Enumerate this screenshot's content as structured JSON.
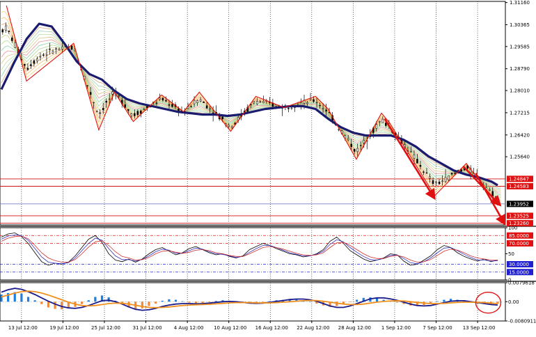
{
  "chart_data": [
    {
      "type": "candlestick",
      "panel": "price",
      "ylim": [
        1.232,
        1.312
      ],
      "y_ticks": [
        "1.31160",
        "1.30365",
        "1.29585",
        "1.28790",
        "1.28010",
        "1.27215",
        "1.26420",
        "1.25640"
      ],
      "price_tags": [
        "1.24847",
        "1.24583",
        "1.23952",
        "1.23525",
        "1.23260"
      ],
      "horizontal_levels": [
        1.24847,
        1.24583,
        1.23525,
        1.2326
      ],
      "current_level": 1.23952,
      "overlays": [
        "moving-average ribbon (many colored lines)",
        "thick navy moving average",
        "red zigzag"
      ],
      "annotations": [
        "three red down arrows"
      ],
      "zigzag_points": [
        {
          "t": 0.8,
          "price": 1.3105
        },
        {
          "t": 4.0,
          "price": 1.2835
        },
        {
          "t": 11.5,
          "price": 1.297
        },
        {
          "t": 15.5,
          "price": 1.266
        },
        {
          "t": 18.0,
          "price": 1.2795
        },
        {
          "t": 21.0,
          "price": 1.269
        },
        {
          "t": 25.5,
          "price": 1.2785
        },
        {
          "t": 29.0,
          "price": 1.2725
        },
        {
          "t": 31.5,
          "price": 1.2795
        },
        {
          "t": 36.5,
          "price": 1.2655
        },
        {
          "t": 40.5,
          "price": 1.278
        },
        {
          "t": 45.0,
          "price": 1.274
        },
        {
          "t": 50.0,
          "price": 1.278
        },
        {
          "t": 52.0,
          "price": 1.2735
        },
        {
          "t": 56.5,
          "price": 1.2555
        },
        {
          "t": 60.5,
          "price": 1.272
        },
        {
          "t": 61.8,
          "price": 1.2685
        },
        {
          "t": 69.0,
          "price": 1.2425
        },
        {
          "t": 74.0,
          "price": 1.254
        },
        {
          "t": 79.0,
          "price": 1.239
        }
      ],
      "ma_points": [
        {
          "t": 0.0,
          "price": 1.2805
        },
        {
          "t": 2.0,
          "price": 1.29
        },
        {
          "t": 4.0,
          "price": 1.2985
        },
        {
          "t": 6.0,
          "price": 1.304
        },
        {
          "t": 8.0,
          "price": 1.303
        },
        {
          "t": 10.0,
          "price": 1.297
        },
        {
          "t": 12.0,
          "price": 1.2905
        },
        {
          "t": 14.0,
          "price": 1.286
        },
        {
          "t": 16.0,
          "price": 1.284
        },
        {
          "t": 18.0,
          "price": 1.28
        },
        {
          "t": 20.0,
          "price": 1.277
        },
        {
          "t": 22.0,
          "price": 1.2755
        },
        {
          "t": 24.0,
          "price": 1.2745
        },
        {
          "t": 26.0,
          "price": 1.2735
        },
        {
          "t": 28.0,
          "price": 1.2725
        },
        {
          "t": 30.0,
          "price": 1.272
        },
        {
          "t": 32.0,
          "price": 1.2715
        },
        {
          "t": 34.0,
          "price": 1.2715
        },
        {
          "t": 36.0,
          "price": 1.271
        },
        {
          "t": 38.0,
          "price": 1.2715
        },
        {
          "t": 40.0,
          "price": 1.2725
        },
        {
          "t": 42.0,
          "price": 1.2735
        },
        {
          "t": 44.0,
          "price": 1.274
        },
        {
          "t": 46.0,
          "price": 1.2745
        },
        {
          "t": 48.0,
          "price": 1.2745
        },
        {
          "t": 50.0,
          "price": 1.2735
        },
        {
          "t": 52.0,
          "price": 1.27
        },
        {
          "t": 54.0,
          "price": 1.267
        },
        {
          "t": 56.0,
          "price": 1.265
        },
        {
          "t": 58.0,
          "price": 1.264
        },
        {
          "t": 60.0,
          "price": 1.264
        },
        {
          "t": 62.0,
          "price": 1.264
        },
        {
          "t": 64.0,
          "price": 1.2625
        },
        {
          "t": 66.0,
          "price": 1.26
        },
        {
          "t": 68.0,
          "price": 1.2565
        },
        {
          "t": 70.0,
          "price": 1.254
        },
        {
          "t": 72.0,
          "price": 1.2515
        },
        {
          "t": 74.0,
          "price": 1.25
        },
        {
          "t": 76.0,
          "price": 1.249
        },
        {
          "t": 78.0,
          "price": 1.2475
        },
        {
          "t": 79.0,
          "price": 1.2462
        }
      ],
      "arrows": [
        {
          "from": {
            "t": 61.0,
            "price": 1.27
          },
          "to": {
            "t": 68.8,
            "price": 1.242
          }
        },
        {
          "from": {
            "t": 73.5,
            "price": 1.253
          },
          "to": {
            "t": 79.2,
            "price": 1.2395
          }
        },
        {
          "from": {
            "t": 75.5,
            "price": 1.2505
          },
          "to": {
            "t": 80.0,
            "price": 1.2328
          }
        }
      ]
    },
    {
      "type": "line",
      "panel": "oscillator",
      "ylim": [
        0,
        100
      ],
      "y_ticks": [
        "100",
        "50",
        "0"
      ],
      "level_tags": [
        "85.0000",
        "70.0000",
        "30.0000",
        "15.0000"
      ],
      "levels": [
        85,
        70,
        30,
        15
      ],
      "series": [
        {
          "values": [
            82,
            88,
            90,
            83,
            70,
            52,
            35,
            28,
            32,
            30,
            34,
            46,
            62,
            78,
            85,
            72,
            50,
            38,
            35,
            40,
            34,
            40,
            50,
            58,
            62,
            55,
            48,
            52,
            60,
            64,
            58,
            52,
            48,
            50,
            45,
            42,
            46,
            58,
            64,
            70,
            66,
            60,
            55,
            50,
            48,
            44,
            46,
            50,
            58,
            74,
            82,
            70,
            56,
            48,
            40,
            35,
            38,
            42,
            50,
            48,
            36,
            28,
            30,
            38,
            46,
            58,
            66,
            62,
            52,
            45,
            40,
            36,
            40,
            35,
            38
          ]
        },
        {
          "values": [
            78,
            84,
            86,
            85,
            76,
            60,
            44,
            34,
            32,
            31,
            33,
            42,
            56,
            70,
            80,
            76,
            60,
            46,
            39,
            39,
            36,
            39,
            46,
            54,
            59,
            57,
            51,
            51,
            56,
            61,
            59,
            54,
            50,
            49,
            46,
            43,
            45,
            53,
            60,
            66,
            66,
            62,
            57,
            52,
            49,
            46,
            46,
            49,
            55,
            68,
            77,
            73,
            62,
            53,
            45,
            39,
            38,
            41,
            47,
            48,
            41,
            33,
            31,
            35,
            42,
            52,
            61,
            62,
            56,
            49,
            43,
            38,
            38,
            36,
            37
          ]
        },
        {
          "values": [
            74,
            80,
            83,
            84,
            79,
            66,
            52,
            42,
            37,
            34,
            34,
            39,
            50,
            63,
            73,
            75,
            66,
            54,
            45,
            42,
            38,
            39,
            43,
            50,
            55,
            56,
            53,
            51,
            53,
            57,
            58,
            56,
            52,
            50,
            47,
            45,
            45,
            50,
            56,
            62,
            64,
            62,
            59,
            55,
            51,
            48,
            47,
            48,
            52,
            62,
            71,
            72,
            66,
            58,
            50,
            44,
            41,
            41,
            45,
            47,
            44,
            38,
            34,
            35,
            39,
            47,
            55,
            59,
            57,
            52,
            46,
            42,
            40,
            38,
            38
          ]
        }
      ]
    },
    {
      "type": "bar+line",
      "panel": "macd",
      "ylim": [
        -0.0080911,
        0.0079618
      ],
      "y_ticks": [
        "0.0079618",
        "0.00",
        "-0.0080911"
      ],
      "histogram": [
        0.003,
        0.0036,
        0.004,
        0.0034,
        0.002,
        0.0006,
        -0.001,
        -0.0024,
        -0.003,
        -0.0032,
        -0.0028,
        -0.0022,
        -0.001,
        0.0006,
        0.002,
        0.0026,
        0.0018,
        0.0004,
        -0.001,
        -0.0024,
        -0.0032,
        -0.0028,
        -0.0018,
        -0.0008,
        0.0004,
        0.001,
        0.0008,
        0.0002,
        -0.0004,
        -0.0008,
        -0.0006,
        -0.0002,
        0.0003,
        0.0006,
        0.0004,
        0.0,
        -0.0004,
        -0.0006,
        -0.0004,
        -0.0002,
        0.0002,
        0.0006,
        0.0008,
        0.001,
        0.0008,
        0.0004,
        0.0,
        -0.0008,
        -0.0016,
        -0.0022,
        -0.0018,
        -0.001,
        -0.0002,
        0.0008,
        0.0016,
        0.0018,
        0.0014,
        0.0008,
        0.0002,
        -0.0004,
        -0.001,
        -0.0016,
        -0.0018,
        -0.0014,
        -0.0006,
        0.0002,
        0.0008,
        0.0012,
        0.0008,
        0.0004,
        -0.0004,
        -0.0008,
        -0.001,
        -0.0012,
        -0.0008
      ],
      "series": [
        {
          "values": [
            0.004,
            0.005,
            0.0056,
            0.0052,
            0.0042,
            0.003,
            0.0016,
            0.0002,
            -0.001,
            -0.002,
            -0.0026,
            -0.0028,
            -0.0024,
            -0.0016,
            -0.0006,
            0.0004,
            0.0006,
            0.0,
            -0.001,
            -0.0022,
            -0.0032,
            -0.0036,
            -0.0034,
            -0.0028,
            -0.002,
            -0.0014,
            -0.001,
            -0.0008,
            -0.0008,
            -0.0009,
            -0.0008,
            -0.0006,
            -0.0003,
            0.0,
            0.0001,
            0.0,
            -0.0003,
            -0.0006,
            -0.0007,
            -0.0006,
            -0.0003,
            0.0001,
            0.0005,
            0.0009,
            0.0011,
            0.0011,
            0.0008,
            0.0002,
            -0.0008,
            -0.0018,
            -0.0024,
            -0.0024,
            -0.0018,
            -0.0008,
            0.0002,
            0.0012,
            0.0016,
            0.0016,
            0.0012,
            0.0006,
            -0.0002,
            -0.001,
            -0.0016,
            -0.0018,
            -0.0016,
            -0.001,
            -0.0004,
            0.0002,
            0.0004,
            0.0004,
            0.0,
            -0.0004,
            -0.0008,
            -0.0012,
            -0.0014
          ]
        },
        {
          "values": [
            0.002,
            0.0028,
            0.0036,
            0.0042,
            0.0044,
            0.0042,
            0.0036,
            0.0028,
            0.0018,
            0.0008,
            -0.0002,
            -0.001,
            -0.0016,
            -0.0018,
            -0.0016,
            -0.0012,
            -0.0008,
            -0.0006,
            -0.0007,
            -0.001,
            -0.0015,
            -0.002,
            -0.0024,
            -0.0025,
            -0.0024,
            -0.0022,
            -0.0019,
            -0.0016,
            -0.0014,
            -0.0013,
            -0.0012,
            -0.0011,
            -0.0009,
            -0.0007,
            -0.0005,
            -0.0004,
            -0.0004,
            -0.0004,
            -0.0005,
            -0.0005,
            -0.0005,
            -0.0004,
            -0.0002,
            0.0,
            0.0002,
            0.0004,
            0.0005,
            0.0005,
            0.0002,
            -0.0002,
            -0.0006,
            -0.001,
            -0.0012,
            -0.0012,
            -0.001,
            -0.0006,
            -0.0002,
            0.0001,
            0.0003,
            0.0004,
            0.0003,
            0.0,
            -0.0003,
            -0.0006,
            -0.0008,
            -0.0008,
            -0.0007,
            -0.0005,
            -0.0003,
            -0.0002,
            -0.0002,
            -0.0003,
            -0.0004,
            -0.0006,
            -0.0008
          ]
        }
      ]
    }
  ],
  "x_tick_labels": [
    "13 Jul 12:00",
    "19 Jul 12:00",
    "25 Jul 12:00",
    "31 Jul 12:00",
    "4 Aug 12:00",
    "10 Aug 12:00",
    "16 Aug 12:00",
    "22 Aug 12:00",
    "28 Aug 12:00",
    "1 Sep 12:00",
    "7 Sep 12:00",
    "13 Sep 12:00"
  ],
  "colors": {
    "background": "#ffffff",
    "grid": "#000000",
    "candle": "#000000",
    "ma_main": "#1a1a6e",
    "zigzag": "#e01010",
    "level_line": "#d01010",
    "current_line": "#7080c0",
    "price_tag": "#e01010",
    "current_tag": "#000000",
    "osc_line1": "#000000",
    "osc_line2": "#3030c0",
    "osc_line3": "#d03030",
    "osc_level_high": "#e01010",
    "osc_level_low": "#2020d0",
    "hist_pos": "#1e7fe0",
    "hist_neg": "#f08a3c",
    "macd_line": "#1a1a8a",
    "signal_line": "#f0901e",
    "circle": "#e01010"
  }
}
